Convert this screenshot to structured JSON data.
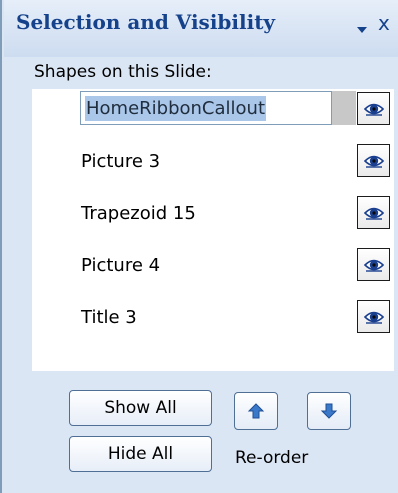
{
  "panel": {
    "title": "Selection and Visibility",
    "close_glyph": "x",
    "dropdown_icon": "chevron-down-icon",
    "close_icon": "close-icon"
  },
  "shapes_label": "Shapes on this Slide:",
  "shapes": [
    {
      "name": "HomeRibbonCallout",
      "selected": true,
      "visible": true
    },
    {
      "name": "Picture 3",
      "selected": false,
      "visible": true
    },
    {
      "name": "Trapezoid 15",
      "selected": false,
      "visible": true
    },
    {
      "name": "Picture 4",
      "selected": false,
      "visible": true
    },
    {
      "name": "Title 3",
      "selected": false,
      "visible": true
    }
  ],
  "buttons": {
    "show_all": "Show All",
    "hide_all": "Hide All"
  },
  "reorder": {
    "label": "Re-order",
    "up_icon": "arrow-up-icon",
    "down_icon": "arrow-down-icon"
  },
  "colors": {
    "panel_bg": "#dbe6f4",
    "title_text": "#15428b",
    "selection_highlight": "#aac6e9",
    "arrow_blue": "#3a78c9"
  }
}
